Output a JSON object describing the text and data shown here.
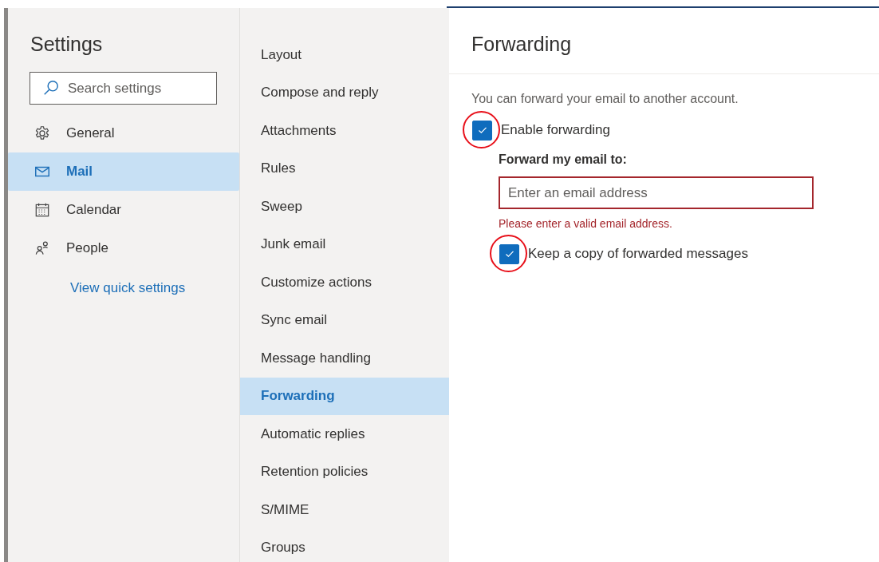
{
  "sidebar": {
    "title": "Settings",
    "search": {
      "placeholder": "Search settings"
    },
    "items": [
      {
        "label": "General",
        "selected": false
      },
      {
        "label": "Mail",
        "selected": true
      },
      {
        "label": "Calendar",
        "selected": false
      },
      {
        "label": "People",
        "selected": false
      }
    ],
    "link": "View quick settings"
  },
  "submenu": {
    "items": [
      {
        "label": "Layout",
        "selected": false
      },
      {
        "label": "Compose and reply",
        "selected": false
      },
      {
        "label": "Attachments",
        "selected": false
      },
      {
        "label": "Rules",
        "selected": false
      },
      {
        "label": "Sweep",
        "selected": false
      },
      {
        "label": "Junk email",
        "selected": false
      },
      {
        "label": "Customize actions",
        "selected": false
      },
      {
        "label": "Sync email",
        "selected": false
      },
      {
        "label": "Message handling",
        "selected": false
      },
      {
        "label": "Forwarding",
        "selected": true
      },
      {
        "label": "Automatic replies",
        "selected": false
      },
      {
        "label": "Retention policies",
        "selected": false
      },
      {
        "label": "S/MIME",
        "selected": false
      },
      {
        "label": "Groups",
        "selected": false
      }
    ]
  },
  "content": {
    "title": "Forwarding",
    "description": "You can forward your email to another account.",
    "options": [
      {
        "kind": "checkbox",
        "label": "Enable forwarding",
        "checked": true,
        "circled": true,
        "children": [
          {
            "kind": "field",
            "label": "Forward my email to:",
            "placeholder": "Enter an email address",
            "error": "Please enter a valid email address."
          },
          {
            "kind": "checkbox",
            "label": "Keep a copy of forwarded messages",
            "checked": true,
            "circled": true
          }
        ]
      }
    ]
  }
}
